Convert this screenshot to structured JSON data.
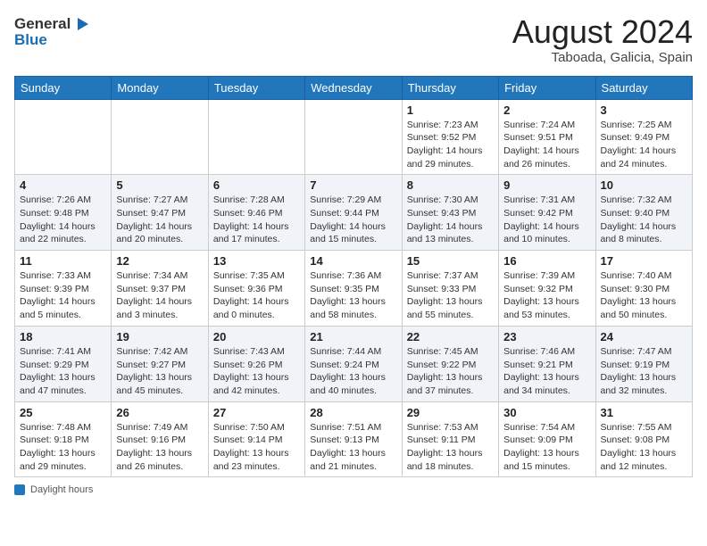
{
  "header": {
    "logo_line1": "General",
    "logo_line2": "Blue",
    "title": "August 2024",
    "subtitle": "Taboada, Galicia, Spain"
  },
  "columns": [
    "Sunday",
    "Monday",
    "Tuesday",
    "Wednesday",
    "Thursday",
    "Friday",
    "Saturday"
  ],
  "weeks": [
    [
      {
        "day": "",
        "info": ""
      },
      {
        "day": "",
        "info": ""
      },
      {
        "day": "",
        "info": ""
      },
      {
        "day": "",
        "info": ""
      },
      {
        "day": "1",
        "info": "Sunrise: 7:23 AM\nSunset: 9:52 PM\nDaylight: 14 hours\nand 29 minutes."
      },
      {
        "day": "2",
        "info": "Sunrise: 7:24 AM\nSunset: 9:51 PM\nDaylight: 14 hours\nand 26 minutes."
      },
      {
        "day": "3",
        "info": "Sunrise: 7:25 AM\nSunset: 9:49 PM\nDaylight: 14 hours\nand 24 minutes."
      }
    ],
    [
      {
        "day": "4",
        "info": "Sunrise: 7:26 AM\nSunset: 9:48 PM\nDaylight: 14 hours\nand 22 minutes."
      },
      {
        "day": "5",
        "info": "Sunrise: 7:27 AM\nSunset: 9:47 PM\nDaylight: 14 hours\nand 20 minutes."
      },
      {
        "day": "6",
        "info": "Sunrise: 7:28 AM\nSunset: 9:46 PM\nDaylight: 14 hours\nand 17 minutes."
      },
      {
        "day": "7",
        "info": "Sunrise: 7:29 AM\nSunset: 9:44 PM\nDaylight: 14 hours\nand 15 minutes."
      },
      {
        "day": "8",
        "info": "Sunrise: 7:30 AM\nSunset: 9:43 PM\nDaylight: 14 hours\nand 13 minutes."
      },
      {
        "day": "9",
        "info": "Sunrise: 7:31 AM\nSunset: 9:42 PM\nDaylight: 14 hours\nand 10 minutes."
      },
      {
        "day": "10",
        "info": "Sunrise: 7:32 AM\nSunset: 9:40 PM\nDaylight: 14 hours\nand 8 minutes."
      }
    ],
    [
      {
        "day": "11",
        "info": "Sunrise: 7:33 AM\nSunset: 9:39 PM\nDaylight: 14 hours\nand 5 minutes."
      },
      {
        "day": "12",
        "info": "Sunrise: 7:34 AM\nSunset: 9:37 PM\nDaylight: 14 hours\nand 3 minutes."
      },
      {
        "day": "13",
        "info": "Sunrise: 7:35 AM\nSunset: 9:36 PM\nDaylight: 14 hours\nand 0 minutes."
      },
      {
        "day": "14",
        "info": "Sunrise: 7:36 AM\nSunset: 9:35 PM\nDaylight: 13 hours\nand 58 minutes."
      },
      {
        "day": "15",
        "info": "Sunrise: 7:37 AM\nSunset: 9:33 PM\nDaylight: 13 hours\nand 55 minutes."
      },
      {
        "day": "16",
        "info": "Sunrise: 7:39 AM\nSunset: 9:32 PM\nDaylight: 13 hours\nand 53 minutes."
      },
      {
        "day": "17",
        "info": "Sunrise: 7:40 AM\nSunset: 9:30 PM\nDaylight: 13 hours\nand 50 minutes."
      }
    ],
    [
      {
        "day": "18",
        "info": "Sunrise: 7:41 AM\nSunset: 9:29 PM\nDaylight: 13 hours\nand 47 minutes."
      },
      {
        "day": "19",
        "info": "Sunrise: 7:42 AM\nSunset: 9:27 PM\nDaylight: 13 hours\nand 45 minutes."
      },
      {
        "day": "20",
        "info": "Sunrise: 7:43 AM\nSunset: 9:26 PM\nDaylight: 13 hours\nand 42 minutes."
      },
      {
        "day": "21",
        "info": "Sunrise: 7:44 AM\nSunset: 9:24 PM\nDaylight: 13 hours\nand 40 minutes."
      },
      {
        "day": "22",
        "info": "Sunrise: 7:45 AM\nSunset: 9:22 PM\nDaylight: 13 hours\nand 37 minutes."
      },
      {
        "day": "23",
        "info": "Sunrise: 7:46 AM\nSunset: 9:21 PM\nDaylight: 13 hours\nand 34 minutes."
      },
      {
        "day": "24",
        "info": "Sunrise: 7:47 AM\nSunset: 9:19 PM\nDaylight: 13 hours\nand 32 minutes."
      }
    ],
    [
      {
        "day": "25",
        "info": "Sunrise: 7:48 AM\nSunset: 9:18 PM\nDaylight: 13 hours\nand 29 minutes."
      },
      {
        "day": "26",
        "info": "Sunrise: 7:49 AM\nSunset: 9:16 PM\nDaylight: 13 hours\nand 26 minutes."
      },
      {
        "day": "27",
        "info": "Sunrise: 7:50 AM\nSunset: 9:14 PM\nDaylight: 13 hours\nand 23 minutes."
      },
      {
        "day": "28",
        "info": "Sunrise: 7:51 AM\nSunset: 9:13 PM\nDaylight: 13 hours\nand 21 minutes."
      },
      {
        "day": "29",
        "info": "Sunrise: 7:53 AM\nSunset: 9:11 PM\nDaylight: 13 hours\nand 18 minutes."
      },
      {
        "day": "30",
        "info": "Sunrise: 7:54 AM\nSunset: 9:09 PM\nDaylight: 13 hours\nand 15 minutes."
      },
      {
        "day": "31",
        "info": "Sunrise: 7:55 AM\nSunset: 9:08 PM\nDaylight: 13 hours\nand 12 minutes."
      }
    ]
  ],
  "footer": {
    "label": "Daylight hours"
  }
}
